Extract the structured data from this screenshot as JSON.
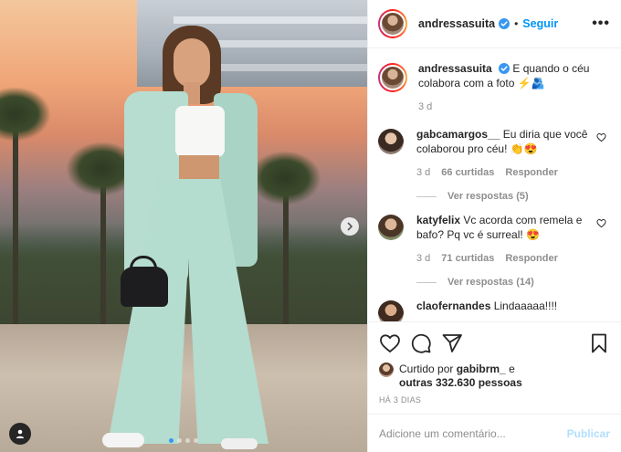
{
  "post": {
    "username": "andressasuita",
    "separator": "•",
    "follow_label": "Seguir",
    "more_label": "•••",
    "caption": "E quando o céu colabora com a foto ⚡🫂",
    "caption_time": "3 d"
  },
  "comments": [
    {
      "username": "gabcamargos__",
      "text": "Eu diria que você colaborou pro céu! 👏😍",
      "time": "3 d",
      "likes": "66 curtidas",
      "reply": "Responder",
      "view_replies": "Ver respostas (5)"
    },
    {
      "username": "katyfelix",
      "text": "Vc acorda com remela e bafo? Pq vc é surreal! 😍",
      "time": "3 d",
      "likes": "71 curtidas",
      "reply": "Responder",
      "view_replies": "Ver respostas (14)"
    },
    {
      "username": "claofernandes",
      "text": "Lindaaaaa!!!!"
    }
  ],
  "footer": {
    "liked_prefix": "Curtido por",
    "liked_user": "gabibrm_",
    "liked_and": "e",
    "liked_others": "outras 332.630 pessoas",
    "date": "HÁ 3 DIAS",
    "comment_placeholder": "Adicione um comentário...",
    "publish_label": "Publicar"
  },
  "media": {
    "carousel_total": 4,
    "carousel_active": 1
  },
  "colors": {
    "follow": "#0095f6",
    "verified": "#3897f0",
    "publish_disabled": "#b2dffc",
    "muted": "#8e8e8e"
  }
}
